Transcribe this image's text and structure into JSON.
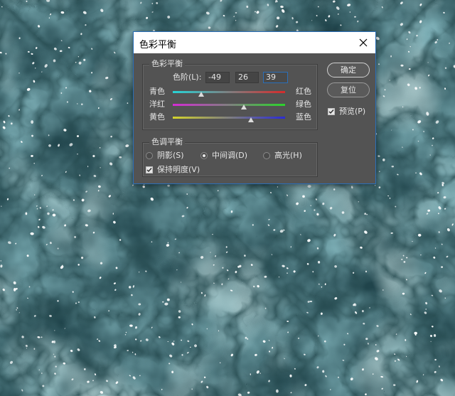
{
  "dialog": {
    "title": "色彩平衡",
    "close_glyph": "✕"
  },
  "color_balance": {
    "group_label": "色彩平衡",
    "levels_label": "色阶(L):",
    "level_values": [
      "-49",
      "26",
      "39"
    ],
    "sliders": [
      {
        "left_label": "青色",
        "right_label": "红色",
        "value": -49,
        "gradient": [
          "#27d3d6",
          "#d62b2b"
        ]
      },
      {
        "left_label": "洋红",
        "right_label": "绿色",
        "value": 26,
        "gradient": [
          "#d42bd4",
          "#2bd42b"
        ]
      },
      {
        "left_label": "黄色",
        "right_label": "蓝色",
        "value": 39,
        "gradient": [
          "#d4d42b",
          "#2b2bd4"
        ]
      }
    ],
    "range": [
      -100,
      100
    ]
  },
  "tone_balance": {
    "group_label": "色调平衡",
    "options": [
      {
        "label": "阴影(S)",
        "checked": false
      },
      {
        "label": "中间调(D)",
        "checked": true
      },
      {
        "label": "高光(H)",
        "checked": false
      }
    ],
    "preserve_label": "保持明度(V)",
    "preserve_checked": true
  },
  "buttons": {
    "ok_label": "确定",
    "reset_label": "复位",
    "preview_label": "预览(P)",
    "preview_checked": true
  },
  "colors": {
    "dialog_bg": "#535353",
    "accent": "#2b6fb8",
    "text": "#e6e6e6"
  }
}
